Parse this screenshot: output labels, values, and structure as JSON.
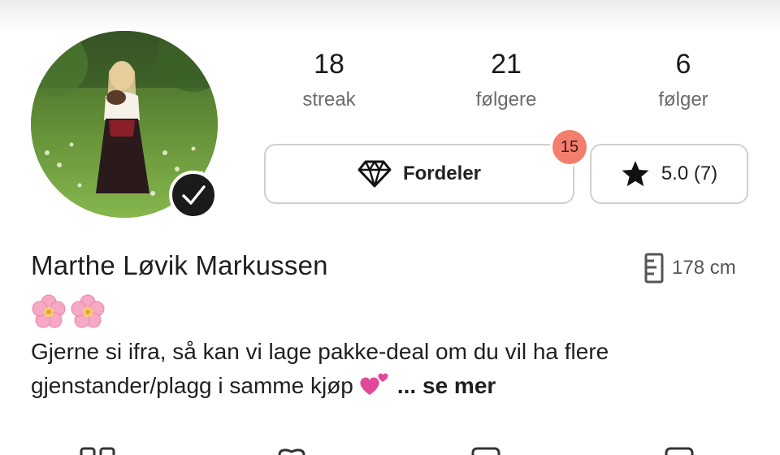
{
  "profile": {
    "name": "Marthe Løvik Markussen",
    "height": "178 cm",
    "verified": true
  },
  "stats": [
    {
      "value": "18",
      "label": "streak"
    },
    {
      "value": "21",
      "label": "følgere"
    },
    {
      "value": "6",
      "label": "følger"
    }
  ],
  "actions": {
    "benefits_label": "Fordeler",
    "benefits_badge": "15",
    "rating_label": "5.0 (7)"
  },
  "bio": {
    "text": "Gjerne si ifra, så kan vi lage pakke-deal om du vil ha flere gjenstander/plagg i samme kjøp",
    "see_more": "... se mer"
  },
  "icons": {
    "benefits": "diamond-icon",
    "rating": "star-icon",
    "height": "ruler-icon",
    "verified": "checkmark-icon",
    "bio_emoji": [
      "cherry-blossom-icon",
      "cherry-blossom-icon",
      "two-hearts-icon"
    ]
  },
  "colors": {
    "badge": "#f47e6e",
    "border": "#cfcfcf",
    "muted_text": "#6b6b6b"
  }
}
